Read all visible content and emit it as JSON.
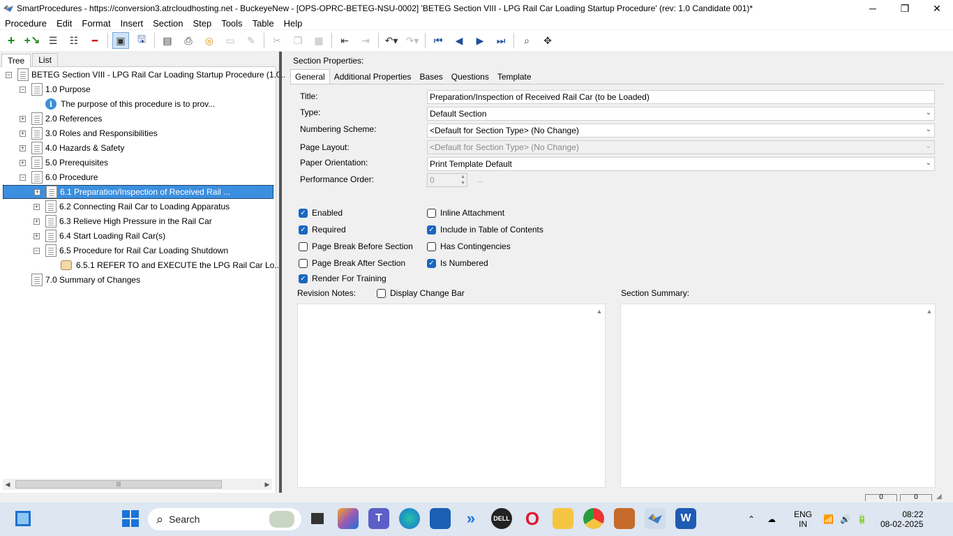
{
  "window": {
    "title": "SmartProcedures - https://conversion3.atrcloudhosting.net - BuckeyeNew - [OPS-OPRC-BETEG-NSU-0002] 'BETEG Section VIII - LPG Rail Car Loading Startup Procedure' (rev: 1.0 Candidate 001)*",
    "min": "─",
    "max": "❐",
    "close": "✕"
  },
  "menu": [
    "Procedure",
    "Edit",
    "Format",
    "Insert",
    "Section",
    "Step",
    "Tools",
    "Table",
    "Help"
  ],
  "left_tabs": [
    "Tree",
    "List"
  ],
  "tree": [
    {
      "label": "BETEG Section VIII - LPG Rail Car Loading Startup Procedure (1.0...",
      "exp": "−",
      "icon": "doc"
    },
    {
      "label": "1.0 Purpose",
      "exp": "−",
      "icon": "doc"
    },
    {
      "label": "The purpose of this procedure is to prov...",
      "exp": "",
      "icon": "info"
    },
    {
      "label": "2.0 References",
      "exp": "+",
      "icon": "doc"
    },
    {
      "label": "3.0 Roles and Responsibilities",
      "exp": "+",
      "icon": "doc"
    },
    {
      "label": "4.0 Hazards & Safety",
      "exp": "+",
      "icon": "doc"
    },
    {
      "label": "5.0 Prerequisites",
      "exp": "+",
      "icon": "doc"
    },
    {
      "label": "6.0 Procedure",
      "exp": "−",
      "icon": "doc"
    },
    {
      "label": "6.1 Preparation/Inspection of Received Rail ...",
      "exp": "+",
      "icon": "doc"
    },
    {
      "label": "6.2 Connecting Rail Car to Loading Apparatus",
      "exp": "+",
      "icon": "doc"
    },
    {
      "label": "6.3 Relieve High Pressure in the Rail Car",
      "exp": "+",
      "icon": "doc"
    },
    {
      "label": "6.4 Start Loading Rail Car(s)",
      "exp": "+",
      "icon": "doc"
    },
    {
      "label": "6.5 Procedure for Rail Car Loading Shutdown",
      "exp": "−",
      "icon": "doc"
    },
    {
      "label": "6.5.1 REFER TO and EXECUTE the LPG Rail Car Lo...",
      "exp": "",
      "icon": "hand"
    },
    {
      "label": "7.0 Summary of Changes",
      "exp": "",
      "icon": "doc"
    }
  ],
  "section_properties_label": "Section Properties:",
  "right_tabs": [
    "General",
    "Additional Properties",
    "Bases",
    "Questions",
    "Template"
  ],
  "fields": {
    "title_label": "Title:",
    "title_value": "Preparation/Inspection of Received Rail Car (to be Loaded)",
    "type_label": "Type:",
    "type_value": "Default Section",
    "numbering_label": "Numbering Scheme:",
    "numbering_value": "<Default for Section Type> (No Change)",
    "layout_label": "Page Layout:",
    "layout_value": "<Default for Section Type> (No Change)",
    "orientation_label": "Paper Orientation:",
    "orientation_value": "Print Template Default",
    "performance_label": "Performance Order:",
    "performance_value": "0",
    "ellipsis": "..."
  },
  "checkboxes": {
    "enabled": {
      "label": "Enabled",
      "checked": true
    },
    "required": {
      "label": "Required",
      "checked": true
    },
    "page_break_before": {
      "label": "Page Break Before Section",
      "checked": false
    },
    "page_break_after": {
      "label": "Page Break After Section",
      "checked": false
    },
    "render_training": {
      "label": "Render For Training",
      "checked": true
    },
    "inline_attachment": {
      "label": "Inline Attachment",
      "checked": false
    },
    "include_toc": {
      "label": "Include in Table of Contents",
      "checked": true
    },
    "has_contingencies": {
      "label": "Has Contingencies",
      "checked": false
    },
    "is_numbered": {
      "label": "Is Numbered",
      "checked": true
    },
    "display_change_bar": {
      "label": "Display Change Bar",
      "checked": false
    }
  },
  "revision_notes_label": "Revision Notes:",
  "section_summary_label": "Section Summary:",
  "status": [
    "0",
    "0"
  ],
  "taskbar": {
    "search": "Search",
    "lang1": "ENG",
    "lang2": "IN",
    "time": "08:22",
    "date": "08-02-2025"
  }
}
